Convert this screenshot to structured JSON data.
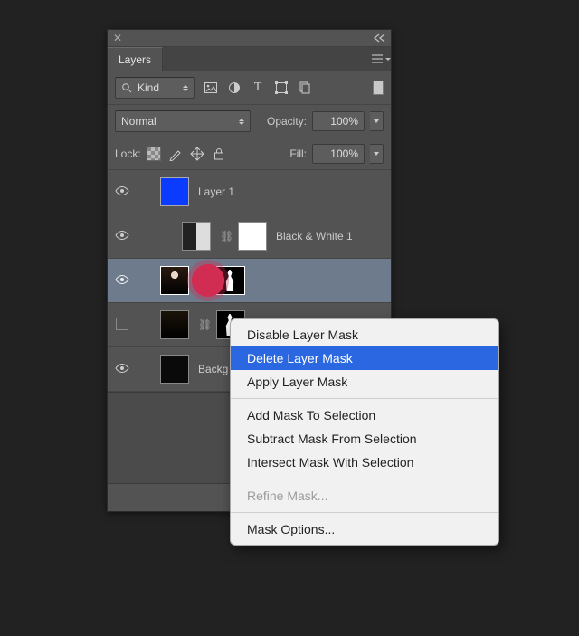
{
  "panel": {
    "tab_label": "Layers",
    "kind_label": "Kind",
    "blend_mode": "Normal",
    "opacity_label": "Opacity:",
    "opacity_value": "100%",
    "lock_label": "Lock:",
    "fill_label": "Fill:",
    "fill_value": "100%"
  },
  "layers": [
    {
      "name": "Layer 1"
    },
    {
      "name": "Black & White 1"
    },
    {
      "name": ""
    },
    {
      "name": ""
    },
    {
      "name": "Backg"
    }
  ],
  "context_menu": {
    "items": [
      "Disable Layer Mask",
      "Delete Layer Mask",
      "Apply Layer Mask",
      "Add Mask To Selection",
      "Subtract Mask From Selection",
      "Intersect Mask With Selection",
      "Refine Mask...",
      "Mask Options..."
    ],
    "highlighted_index": 1,
    "disabled_index": 6
  }
}
